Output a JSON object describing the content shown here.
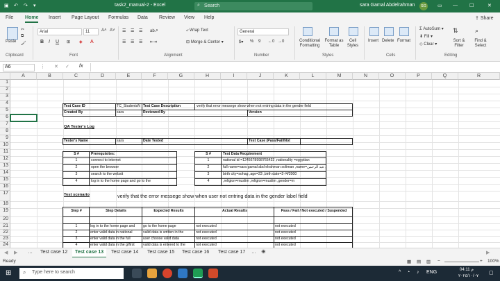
{
  "titlebar": {
    "filename": "task2_manual-2  -  Excel",
    "search_placeholder": "Search",
    "user": "sara  Gamal Abdelrahman",
    "user_initials": "SG"
  },
  "tabs": [
    "File",
    "Home",
    "Insert",
    "Page Layout",
    "Formulas",
    "Data",
    "Review",
    "View",
    "Help"
  ],
  "active_tab": "Home",
  "share": "Share",
  "ribbon": {
    "clipboard": {
      "label": "Clipboard",
      "paste": "Paste"
    },
    "font": {
      "label": "Font",
      "name": "Arial",
      "size": "11"
    },
    "alignment": {
      "label": "Alignment",
      "wrap": "Wrap Text",
      "merge": "Merge & Center"
    },
    "number": {
      "label": "Number",
      "format": "General",
      "percent": "%",
      "comma": "9"
    },
    "styles": {
      "label": "Styles",
      "conditional": "Conditional Formatting",
      "format_table": "Format as Table",
      "cell_styles": "Cell Styles"
    },
    "cells": {
      "label": "Cells",
      "insert": "Insert",
      "delete": "Delete",
      "format": "Format"
    },
    "editing": {
      "label": "Editing",
      "autosum": "AutoSum",
      "fill": "Fill",
      "clear": "Clear",
      "sort": "Sort & Filter",
      "find": "Find & Select"
    }
  },
  "formula_bar": {
    "name_box": "A6",
    "fx": "fx",
    "value": ""
  },
  "columns": [
    "A",
    "B",
    "C",
    "D",
    "E",
    "F",
    "G",
    "H",
    "I",
    "J",
    "K",
    "L",
    "M",
    "N",
    "O",
    "P",
    "Q",
    "R"
  ],
  "rows": [
    "1",
    "2",
    "3",
    "4",
    "5",
    "6",
    "7",
    "8",
    "9",
    "10",
    "11",
    "12",
    "13",
    "14",
    "15",
    "16",
    "17",
    "18",
    "19",
    "20",
    "21",
    "22",
    "23",
    "24"
  ],
  "cells": {
    "test_case_id": "Test Case ID",
    "test_case_id_val": "TC_StudentsN",
    "desc_label": "Test Case Description",
    "desc_val": "verify that error messege show when not entring data in the gender  field",
    "created_by": "Created By",
    "created_by_val": "sara",
    "reviewed_by": "Reviewed By",
    "version": "Version",
    "qa_log": "QA Tester's Log",
    "tester_name": "Tester's Name",
    "tester_name_val": "sara",
    "date_tested": "Date Tested",
    "test_case_result": "Test Case (Pass/Fail/Not",
    "s_no": "S #",
    "prereq": "Prerequisites:",
    "s_no2": "S #",
    "test_data_req": "Test Data Requirement",
    "prereq_items": [
      {
        "n": "1",
        "t": "connect to internet"
      },
      {
        "n": "2",
        "t": "open the browser"
      },
      {
        "n": "3",
        "t": "search to the websit"
      },
      {
        "n": "4",
        "t": "log in to the home page and go to the"
      }
    ],
    "data_items": [
      {
        "n": "1",
        "t": "national id =1245678998765433          ,nationality =egyptian"
      },
      {
        "n": "2",
        "t": "full name=sara gamal abd elrahman soliman       ,name=سارةجمال عبد الرحمن"
      },
      {
        "n": "3",
        "t": "birth city=sohag  ,age=23 ,birth date=2-/4/2000"
      },
      {
        "n": "4",
        "t": ",religion=muslim  ,religion=muslim ,gender=m"
      }
    ],
    "test_scenario": "Test scenario",
    "scenario_text": "verify that the error messege show when user not entring data in the gender  label  field",
    "step_no": "Step #",
    "step_details": "Step Details",
    "expected": "Expected Results",
    "actual": "Actual Results",
    "pass_fail": "Pass / Fail / Not executed / Suspended",
    "steps": [
      {
        "n": "1",
        "d": "log in to the home page and",
        "e": "go to the home page",
        "a": "not executed",
        "p": "not executed"
      },
      {
        "n": "2",
        "d": "enter valid data in  national",
        "e": "valid data is written in the",
        "a": "not executed",
        "p": "not executed"
      },
      {
        "n": "3",
        "d": "enter valid data in the full",
        "e": "user choose valid data",
        "a": "not executed",
        "p": "not executed"
      },
      {
        "n": "4",
        "d": "enter valid data in the g/first",
        "e": "valid data is entered to the",
        "a": "not executed",
        "p": "not executed"
      }
    ]
  },
  "sheet_tabs": [
    "Test case 12",
    "Test case 13",
    "Test case 14",
    "Test case 15",
    "Test case 16",
    "Test case 17"
  ],
  "active_sheet": "Test case 13",
  "status": {
    "ready": "Ready",
    "zoom": "100%"
  },
  "taskbar": {
    "search_placeholder": "Type here to search",
    "lang": "ENG",
    "time": "04:11 م",
    "date": "٢٠٢٤/١٠/٠٧"
  }
}
